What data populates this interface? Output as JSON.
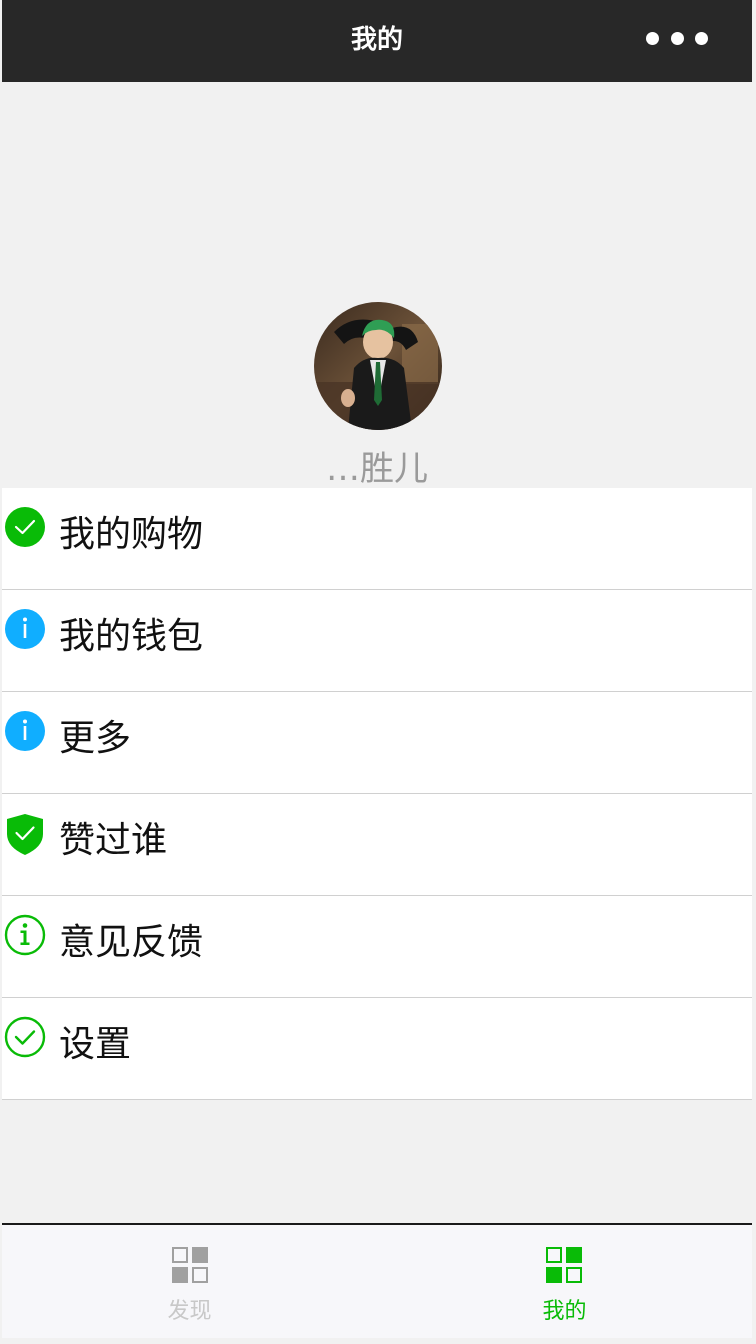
{
  "header": {
    "title": "我的",
    "more_icon": "more-dots-icon"
  },
  "profile": {
    "avatar_icon": "user-avatar",
    "name": "…胜儿"
  },
  "menu": {
    "items": [
      {
        "label": "我的购物",
        "icon": "success-filled-icon",
        "icon_color": "#09bb07"
      },
      {
        "label": "我的钱包",
        "icon": "info-filled-icon",
        "icon_color": "#10aeff"
      },
      {
        "label": "更多",
        "icon": "info-filled-icon",
        "icon_color": "#10aeff"
      },
      {
        "label": "赞过谁",
        "icon": "safe-shield-icon",
        "icon_color": "#09bb07"
      },
      {
        "label": "意见反馈",
        "icon": "info-outline-icon",
        "icon_color": "#09bb07"
      },
      {
        "label": "设置",
        "icon": "success-outline-icon",
        "icon_color": "#09bb07"
      }
    ]
  },
  "tabbar": {
    "tabs": [
      {
        "label": "发现",
        "icon": "grid-icon",
        "active": false,
        "color": "#a0a0a0"
      },
      {
        "label": "我的",
        "icon": "grid-icon",
        "active": true,
        "color": "#09bb07"
      }
    ]
  },
  "colors": {
    "nav_background": "#282828",
    "page_background": "#f1f1f1",
    "accent_green": "#09bb07",
    "accent_blue": "#10aeff"
  }
}
